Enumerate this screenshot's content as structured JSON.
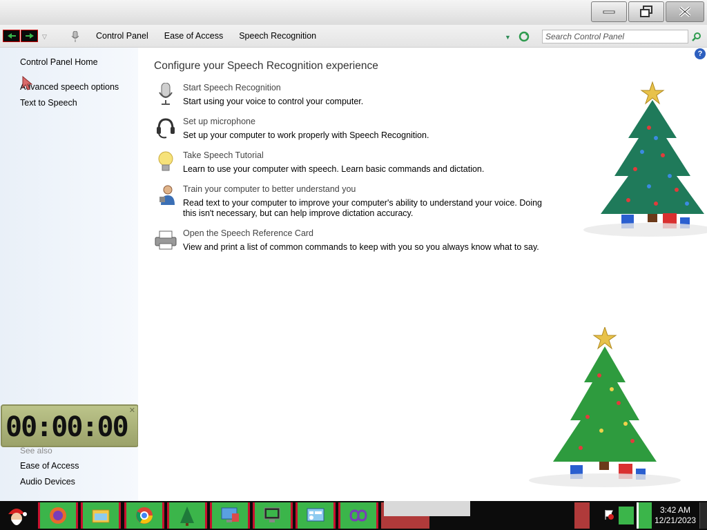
{
  "window": {
    "controls": [
      "minimize",
      "restore",
      "close"
    ]
  },
  "address_bar": {
    "breadcrumbs": [
      "Control Panel",
      "Ease of Access",
      "Speech Recognition"
    ],
    "search_placeholder": "Search Control Panel"
  },
  "left_nav": {
    "home_link": "Control Panel Home",
    "links": [
      "Advanced speech options",
      "Text to Speech"
    ],
    "see_also_label": "See also",
    "see_also_links": [
      "Ease of Access",
      "Audio Devices"
    ]
  },
  "clock_widget": {
    "display": "00:00:00"
  },
  "main": {
    "title": "Configure your Speech Recognition experience",
    "help_label": "?",
    "tasks": [
      {
        "title": "Start Speech Recognition",
        "description": "Start using your voice to control your computer.",
        "icon": "microphone-icon"
      },
      {
        "title": "Set up microphone",
        "description": "Set up your computer to work properly with Speech Recognition.",
        "icon": "headset-icon"
      },
      {
        "title": "Take Speech Tutorial",
        "description": "Learn to use your computer with speech.  Learn basic commands and dictation.",
        "icon": "lightbulb-icon"
      },
      {
        "title": "Train your computer to better understand you",
        "description": "Read text to your computer to improve your computer's ability to understand your voice.  Doing this isn't necessary, but can help improve dictation accuracy.",
        "icon": "user-training-icon"
      },
      {
        "title": "Open the Speech Reference Card",
        "description": "View and print a list of common commands to keep with you so you always know what to say.",
        "icon": "printer-icon"
      }
    ]
  },
  "taskbar": {
    "apps": [
      "santa-start-icon",
      "firefox-icon",
      "file-explorer-icon",
      "chrome-icon",
      "christmas-tree-icon",
      "computer-icon",
      "monitor-icon",
      "control-panel-icon",
      "infinity-icon"
    ],
    "time": "3:42 AM",
    "date": "12/21/2023"
  },
  "colors": {
    "taskbar_accent": "#3bb54a",
    "taskbar_border": "#c8102e",
    "nav_bg": "#e9f0f8"
  }
}
